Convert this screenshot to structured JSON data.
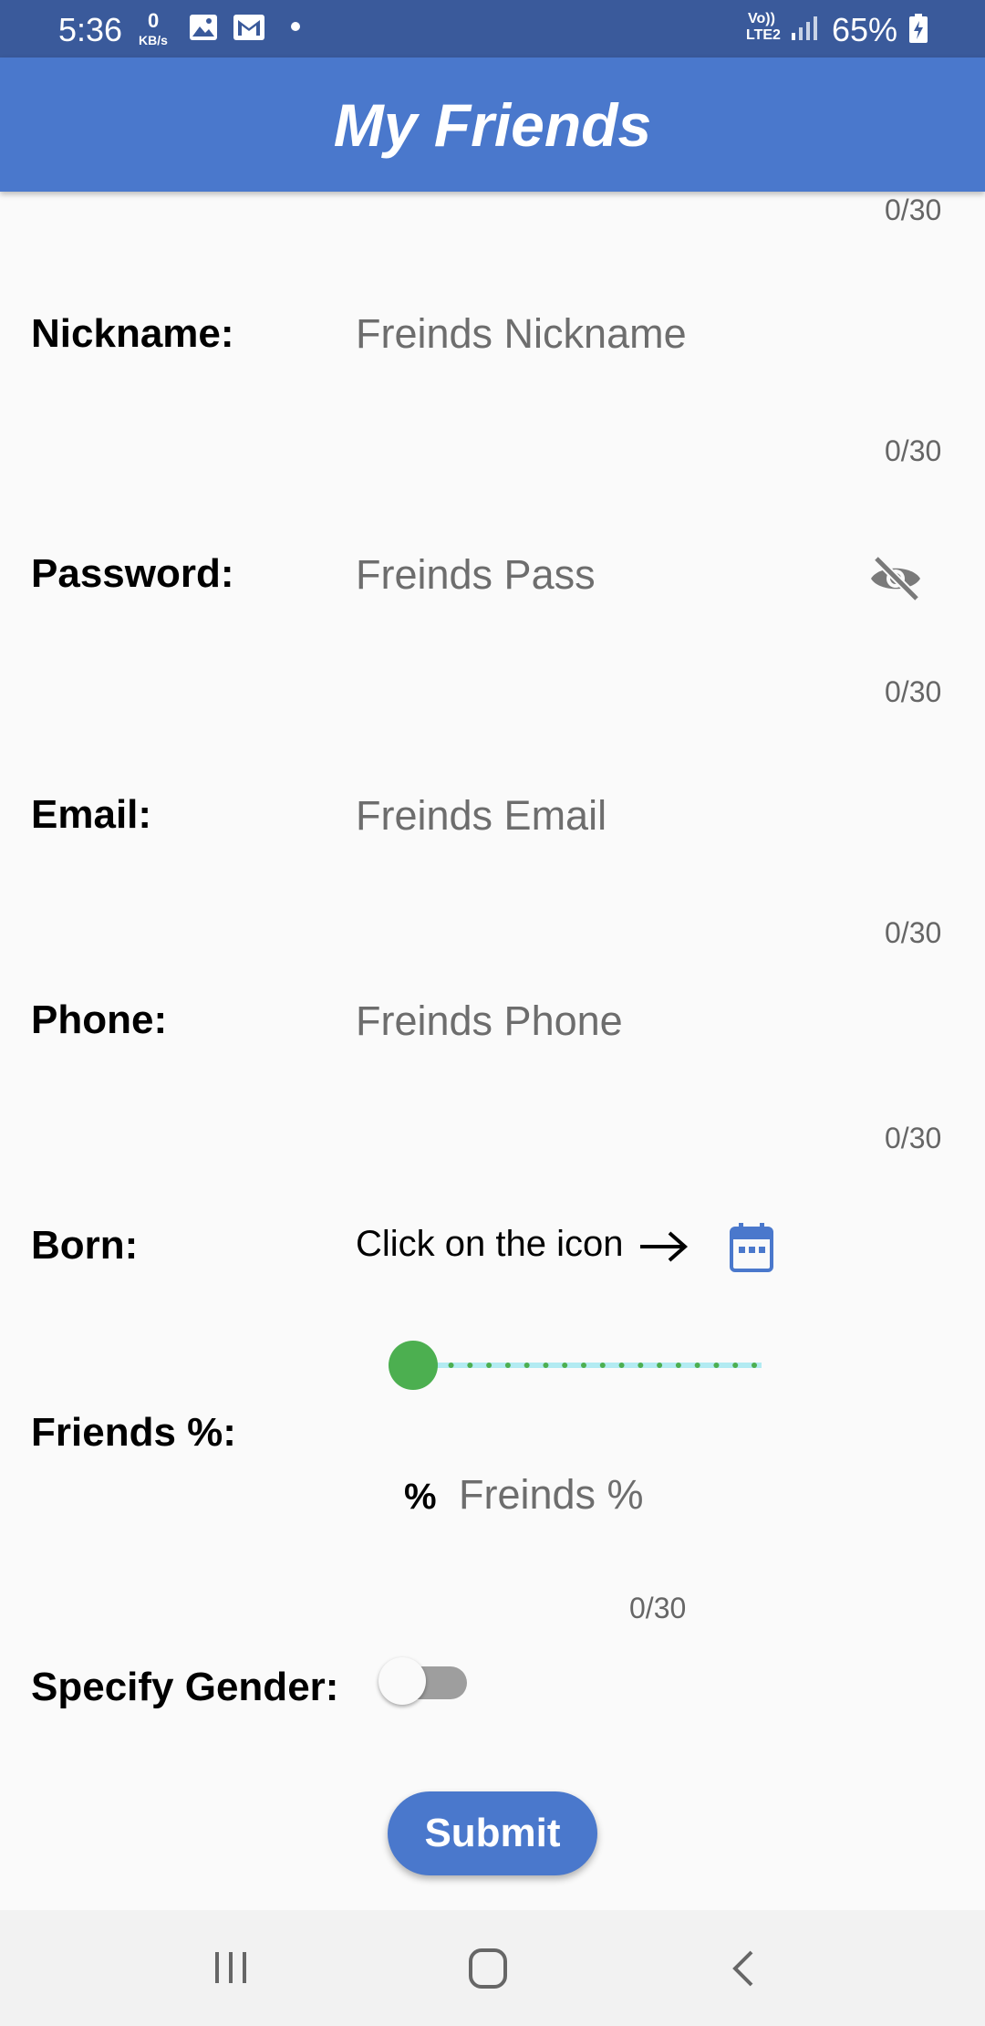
{
  "status_bar": {
    "time": "5:36",
    "speed_value": "0",
    "speed_unit": "KB/s",
    "network_top": "Vo))",
    "network_bottom": "LTE2",
    "battery": "65%",
    "icons": [
      "image-icon",
      "gmail-icon",
      "dot-icon",
      "signal-icon",
      "battery-icon"
    ]
  },
  "app_bar": {
    "title": "My Friends"
  },
  "form": {
    "top_counter": "0/30",
    "nickname": {
      "label": "Nickname:",
      "placeholder": "Freinds Nickname",
      "counter": "0/30"
    },
    "password": {
      "label": "Password:",
      "placeholder": "Freinds Pass",
      "counter": "0/30",
      "icon": "visibility-off-icon"
    },
    "email": {
      "label": "Email:",
      "placeholder": "Freinds Email",
      "counter": "0/30"
    },
    "phone": {
      "label": "Phone:",
      "placeholder": "Freinds Phone",
      "counter": "0/30"
    },
    "born": {
      "label": "Born:",
      "hint": "Click on the icon",
      "icon": "calendar-icon"
    },
    "friends_percent": {
      "label": "Friends %:",
      "slider_value": 0,
      "prefix": "%",
      "placeholder": "Freinds %",
      "counter": "0/30"
    },
    "gender": {
      "label": "Specify Gender:",
      "toggle_on": false
    },
    "submit_label": "Submit"
  },
  "colors": {
    "status_bar": "#3a5a9b",
    "app_bar": "#4a78cc",
    "slider_thumb": "#4caf50",
    "slider_track": "#b2ebf2",
    "background": "#fafafa"
  },
  "nav_bar": {
    "icons": [
      "recents-icon",
      "home-icon",
      "back-icon"
    ]
  }
}
